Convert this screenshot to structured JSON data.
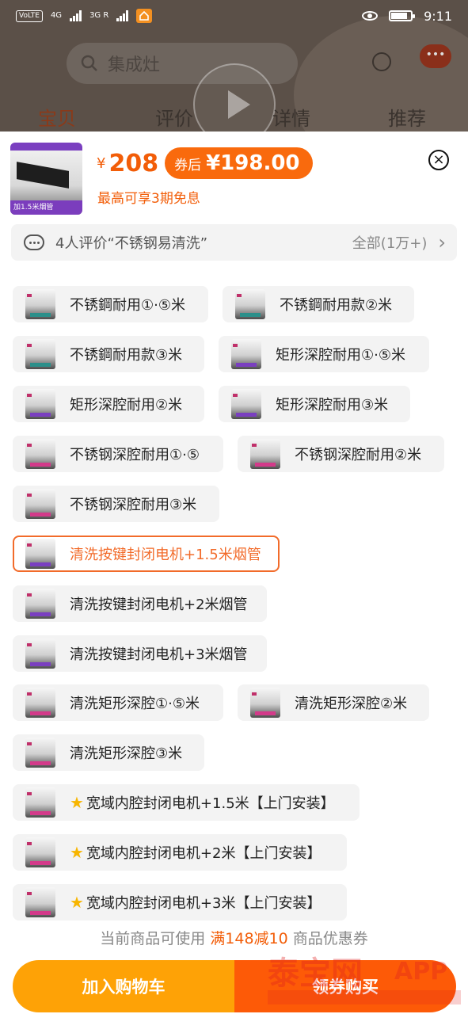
{
  "status_bar": {
    "volte": "VoLTE",
    "net1": "4G",
    "net2": "3G R",
    "time": "9:11"
  },
  "header": {
    "search_text": "集成灶",
    "tabs": [
      "宝贝",
      "评价",
      "详情",
      "推荐"
    ],
    "active_tab": "宝贝"
  },
  "product": {
    "currency": "¥",
    "price": "208",
    "coupon_label": "券后",
    "coupon_price": "¥198.00",
    "installment": "最高可享3期免息",
    "thumb_tag": "加1.5米烟管"
  },
  "review": {
    "text": "4人评价“不锈钢易清洗”",
    "all": "全部(1万+)"
  },
  "skus": [
    {
      "label": "不锈鋼耐用①·⑤米",
      "thumb": "teal",
      "selected": false
    },
    {
      "label": "不锈鋼耐用款②米",
      "thumb": "teal",
      "selected": false
    },
    {
      "label": "不锈鋼耐用款③米",
      "thumb": "teal",
      "selected": false
    },
    {
      "label": "矩形深腔耐用①·⑤米",
      "thumb": "purple",
      "selected": false
    },
    {
      "label": "矩形深腔耐用②米",
      "thumb": "purple",
      "selected": false
    },
    {
      "label": "矩形深腔耐用③米",
      "thumb": "purple",
      "selected": false
    },
    {
      "label": "不锈钢深腔耐用①·⑤",
      "thumb": "pink",
      "selected": false
    },
    {
      "label": "不锈钢深腔耐用②米",
      "thumb": "pink",
      "selected": false
    },
    {
      "label": "不锈钢深腔耐用③米",
      "thumb": "pink",
      "selected": false
    },
    {
      "label": "清洗按键封闭电机+1.5米烟管",
      "thumb": "purple",
      "selected": true
    },
    {
      "label": "清洗按键封闭电机+2米烟管",
      "thumb": "purple",
      "selected": false
    },
    {
      "label": "清洗按键封闭电机+3米烟管",
      "thumb": "purple",
      "selected": false
    },
    {
      "label": "清洗矩形深腔①·⑤米",
      "thumb": "pink",
      "selected": false
    },
    {
      "label": "清洗矩形深腔②米",
      "thumb": "pink",
      "selected": false
    },
    {
      "label": "清洗矩形深腔③米",
      "thumb": "pink",
      "selected": false
    },
    {
      "label": "宽域内腔封闭电机+1.5米【上门安装】",
      "thumb": "pink",
      "selected": false,
      "star": true
    },
    {
      "label": "宽域内腔封闭电机+2米【上门安装】",
      "thumb": "pink",
      "selected": false,
      "star": true
    },
    {
      "label": "宽域内腔封闭电机+3米【上门安装】",
      "thumb": "pink",
      "selected": false,
      "star": true
    }
  ],
  "coupon_hint": {
    "prefix": "当前商品可使用",
    "highlight": "满148减10",
    "suffix": "商品优惠券"
  },
  "buttons": {
    "add_to_cart": "加入购物车",
    "buy": "领券购买"
  },
  "watermark_text": "泰宝网 APP",
  "colors": {
    "accent": "#f25d08",
    "cart_button": "#fea206",
    "buy_button": "#fd5a07",
    "selected_border": "#f26b2a"
  }
}
